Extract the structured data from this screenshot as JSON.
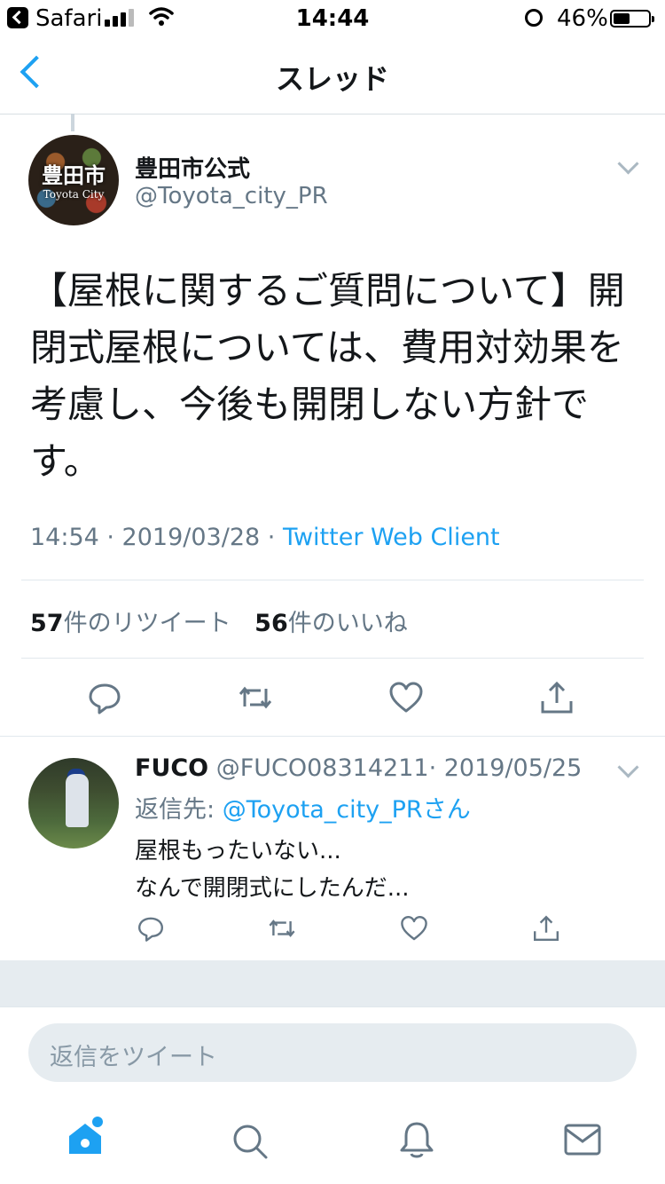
{
  "status_bar": {
    "app": "Safari",
    "time": "14:44",
    "battery": "46%"
  },
  "nav": {
    "title": "スレッド"
  },
  "tweet": {
    "avatar_text": "豊田市",
    "avatar_subtext": "Toyota City",
    "name": "豊田市公式",
    "handle": "@Toyota_city_PR",
    "text": "【屋根に関するご質問について】開閉式屋根については、費用対効果を考慮し、今後も開閉しない方針です。",
    "time": "14:54 · 2019/03/28 · ",
    "client": "Twitter Web Client",
    "retweet_count": "57",
    "retweet_label": "件のリツイート",
    "like_count": "56",
    "like_label": "件のいいね"
  },
  "reply": {
    "name": "FUCO",
    "handle": "@FUCO08314211",
    "date": "· 2019/05/25",
    "reply_to_label": "返信先: ",
    "reply_to": "@Toyota_city_PRさん",
    "line1": "屋根もったいない...",
    "line2": "なんで開閉式にしたんだ..."
  },
  "composer": {
    "placeholder": "返信をツイート"
  },
  "colors": {
    "accent": "#1da1f2",
    "muted": "#657786",
    "border": "#e1e8ed"
  },
  "icons": [
    "reply-icon",
    "retweet-icon",
    "like-icon",
    "share-icon",
    "home-icon",
    "search-icon",
    "notifications-icon",
    "messages-icon"
  ]
}
